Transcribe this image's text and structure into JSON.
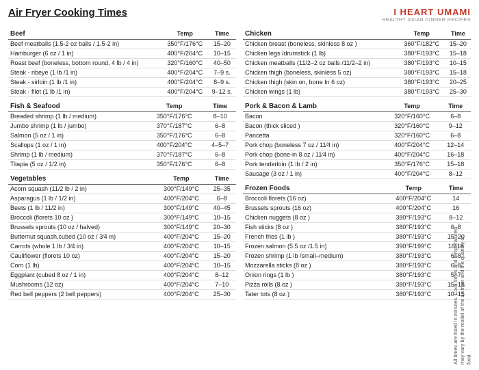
{
  "header": {
    "title": "Air Fryer Cooking Times",
    "logo_line1": "I HEART UMAMI",
    "logo_line2": "",
    "logo_subtitle": "HEALTHY ASIAN DINNER RECIPES"
  },
  "footer": {
    "footnote": "All times are listed in minutes. Cook times and temperatures may vary by the model of the air fryer and the quantity of food."
  },
  "sections": {
    "beef": {
      "title": "Beef",
      "col_temp": "Temp",
      "col_time": "Time",
      "rows": [
        [
          "Beef meatballs (1.5-2 oz balls / 1.5-2 in)",
          "350°F/176°C",
          "15–20"
        ],
        [
          "Hamburger (6 oz / 1 in)",
          "400°F/204°C",
          "10–15"
        ],
        [
          "Roast beef (boneless, bottom round, 4 lb / 4 in)",
          "320°F/160°C",
          "40–50"
        ],
        [
          "Steak - ribeye (1 lb /1 in)",
          "400°F/204°C",
          "7–9 s."
        ],
        [
          "Steak - sirloin (1 lb /1 in)",
          "400°F/204°C",
          "8–9 s."
        ],
        [
          "Steak - filet (1 lb /1 in)",
          "400°F/204°C",
          "9–12 s."
        ]
      ]
    },
    "fish": {
      "title": "Fish & Seafood",
      "col_temp": "Temp",
      "col_time": "Time",
      "rows": [
        [
          "Breaded shrimp (1 lb / medium)",
          "350°F/176°C",
          "8–10"
        ],
        [
          "Jumbo shrimp (1 lb / jumbo)",
          "370°F/187°C",
          "6–8"
        ],
        [
          "Salmon (5 oz / 1 in)",
          "350°F/176°C",
          "6–8"
        ],
        [
          "Scallops (1 oz / 1 in)",
          "400°F/204°C",
          "4–5–7"
        ],
        [
          "Shrimp (1 lb / medium)",
          "370°F/187°C",
          "6–8"
        ],
        [
          "Tilapia (5 oz / 1/2 in)",
          "350°F/176°C",
          "6–8"
        ]
      ]
    },
    "vegetables": {
      "title": "Vegetables",
      "col_temp": "Temp",
      "col_time": "Time",
      "rows": [
        [
          "Acorn squash (11/2 lb / 2 in)",
          "300°F/149°C",
          "25–35"
        ],
        [
          "Asparagus (1 lb / 1/2 in)",
          "400°F/204°C",
          "6–8"
        ],
        [
          "Beets (1 lb / 11/2 in)",
          "300°F/149°C",
          "40–45"
        ],
        [
          "Broccoli (florets 10 oz )",
          "300°F/149°C",
          "10–15"
        ],
        [
          "Brussels sprouts (10 oz / halved)",
          "300°F/149°C",
          "20–30"
        ],
        [
          "Butternut squash,cubed (10 oz / 3⁄4 in)",
          "400°F/204°C",
          "15–20"
        ],
        [
          "Carrots (whole 1 lb / 3⁄4 in)",
          "400°F/204°C",
          "10–15"
        ],
        [
          "Cauliflower (florets 10 oz)",
          "400°F/204°C",
          "15–20"
        ],
        [
          "Corn (1 lb)",
          "400°F/204°C",
          "10–15"
        ],
        [
          "Eggplant (cubed 8 oz / 1 in)",
          "400°F/204°C",
          "8–12"
        ],
        [
          "Mushrooms (12 oz)",
          "400°F/204°C",
          "7–10"
        ],
        [
          "Red bell peppers (2 bell peppers)",
          "400°F/204°C",
          "25–30"
        ]
      ]
    },
    "chicken": {
      "title": "Chicken",
      "col_temp": "Temp",
      "col_time": "Time",
      "rows": [
        [
          "Chicken breast (boneless, skinless 8 oz )",
          "360°F/182°C",
          "15–20"
        ],
        [
          "Chicken legs /drumstick (1 lb)",
          "380°F/193°C",
          "15–18"
        ],
        [
          "Chicken meatballs (11/2–2 oz balls /11/2–2 in)",
          "380°F/193°C",
          "10–15"
        ],
        [
          "Chicken thigh (boneless, skinless 5 oz)",
          "380°F/193°C",
          "15–18"
        ],
        [
          "Chicken thigh (skin on, bone In 6 oz)",
          "380°F/193°C",
          "20–25"
        ],
        [
          "Chicken wings (1 lb)",
          "380°F/193°C",
          "25–30"
        ]
      ]
    },
    "pork": {
      "title": "Pork & Bacon & Lamb",
      "col_temp": "Temp",
      "col_time": "Time",
      "rows": [
        [
          "Bacon",
          "320°F/160°C",
          "6–8"
        ],
        [
          "Bacon (thick sliced )",
          "320°F/160°C",
          "9–12"
        ],
        [
          "Pancetta",
          "320°F/160°C",
          "6–8"
        ],
        [
          "Pork chop (boneless 7 oz / 11⁄4 in)",
          "400°F/204°C",
          "12–14"
        ],
        [
          "Pork chop (bone-in 8 oz / 11⁄4 in)",
          "400°F/204°C",
          "16–18"
        ],
        [
          "Pork tenderloin (1 lb / 2 in)",
          "350°F/176°C",
          "15–18"
        ],
        [
          "Sausage (3 oz / 1 in)",
          "400°F/204°C",
          "8–12"
        ]
      ]
    },
    "frozen": {
      "title": "Frozen Foods",
      "col_temp": "Temp",
      "col_time": "Time",
      "rows": [
        [
          "Broccoli florets (16 oz)",
          "400°F/204°C",
          "14"
        ],
        [
          "Brussels sprouts (16 oz)",
          "400°F/204°C",
          "16"
        ],
        [
          "Chicken nuggets (8 oz )",
          "380°F/193°C",
          "8–12"
        ],
        [
          "Fish sticks (8 oz )",
          "380°F/193°C",
          "6–8"
        ],
        [
          "French fries (1 lb )",
          "380°F/193°C",
          "15–20"
        ],
        [
          "Frozen salmon (5.5 oz /1.5 in)",
          "390°F/199°C",
          "16-18"
        ],
        [
          "Frozen shrimp (1 lb /small–medium)",
          "380°F/193°C",
          "6–8"
        ],
        [
          "Mozzarella sticks (8 oz )",
          "380°F/193°C",
          "6–8"
        ],
        [
          "Onion rings (1 lb )",
          "380°F/193°C",
          "5–7"
        ],
        [
          "Pizza rolls (8 oz )",
          "380°F/193°C",
          "15–18"
        ],
        [
          "Tater tots (8 oz )",
          "380°F/193°C",
          "10–15"
        ]
      ]
    }
  }
}
